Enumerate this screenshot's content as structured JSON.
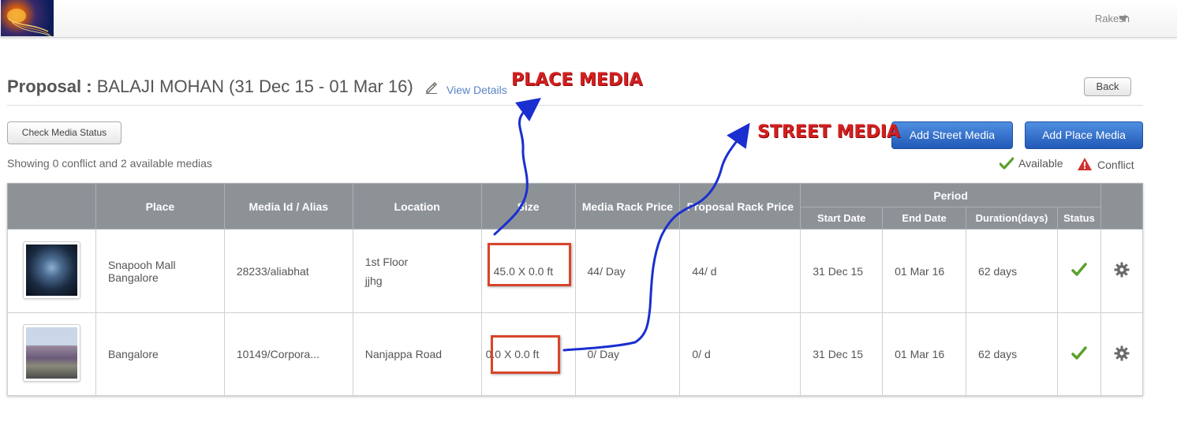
{
  "header": {
    "user_name": "Rakesh"
  },
  "proposal": {
    "label": "Proposal :",
    "name": "BALAJI MOHAN (31 Dec 15 - 01 Mar 16)",
    "view_details": "View Details",
    "back": "Back"
  },
  "toolbar": {
    "check_media_status": "Check Media Status",
    "summary": "Showing 0 conflict and 2 available medias",
    "add_street_media": "Add Street Media",
    "add_place_media": "Add Place Media"
  },
  "legend": {
    "available": "Available",
    "conflict": "Conflict"
  },
  "table": {
    "headers": {
      "place": "Place",
      "media_id": "Media Id / Alias",
      "location": "Location",
      "size": "Size",
      "media_rack_price": "Media Rack Price",
      "proposal_rack_price": "Proposal Rack Price",
      "period": "Period",
      "start_date": "Start Date",
      "end_date": "End Date",
      "duration": "Duration(days)",
      "status": "Status"
    },
    "rows": [
      {
        "place_line1": "Snapooh Mall",
        "place_line2": "Bangalore",
        "media_id": "28233/aliabhat",
        "location_line1": "1st Floor",
        "location_line2": "jjhg",
        "size": "45.0 X 0.0 ft",
        "media_rack_price": "44/ Day",
        "proposal_rack_price": "44/ d",
        "start_date": "31 Dec 15",
        "end_date": "01 Mar 16",
        "duration": "62 days",
        "status": "available"
      },
      {
        "place_line1": "Bangalore",
        "media_id": "10149/Corpora...",
        "location_line1": "Nanjappa Road",
        "size": "0.0 X 0.0 ft",
        "media_rack_price": "0/ Day",
        "proposal_rack_price": "0/ d",
        "start_date": "31 Dec 15",
        "end_date": "01 Mar 16",
        "duration": "62 days",
        "status": "available"
      }
    ]
  },
  "annotations": {
    "place_media": "PLACE MEDIA",
    "street_media": "STREET MEDIA",
    "highlight_color": "#d8452a",
    "arrow_color": "#1a2fd0"
  },
  "colors": {
    "primary_button": "#2f6cc8",
    "table_header": "#8d9297",
    "available_check": "#5aa02c",
    "conflict_warning": "#d23030",
    "link": "#5a84c4"
  }
}
